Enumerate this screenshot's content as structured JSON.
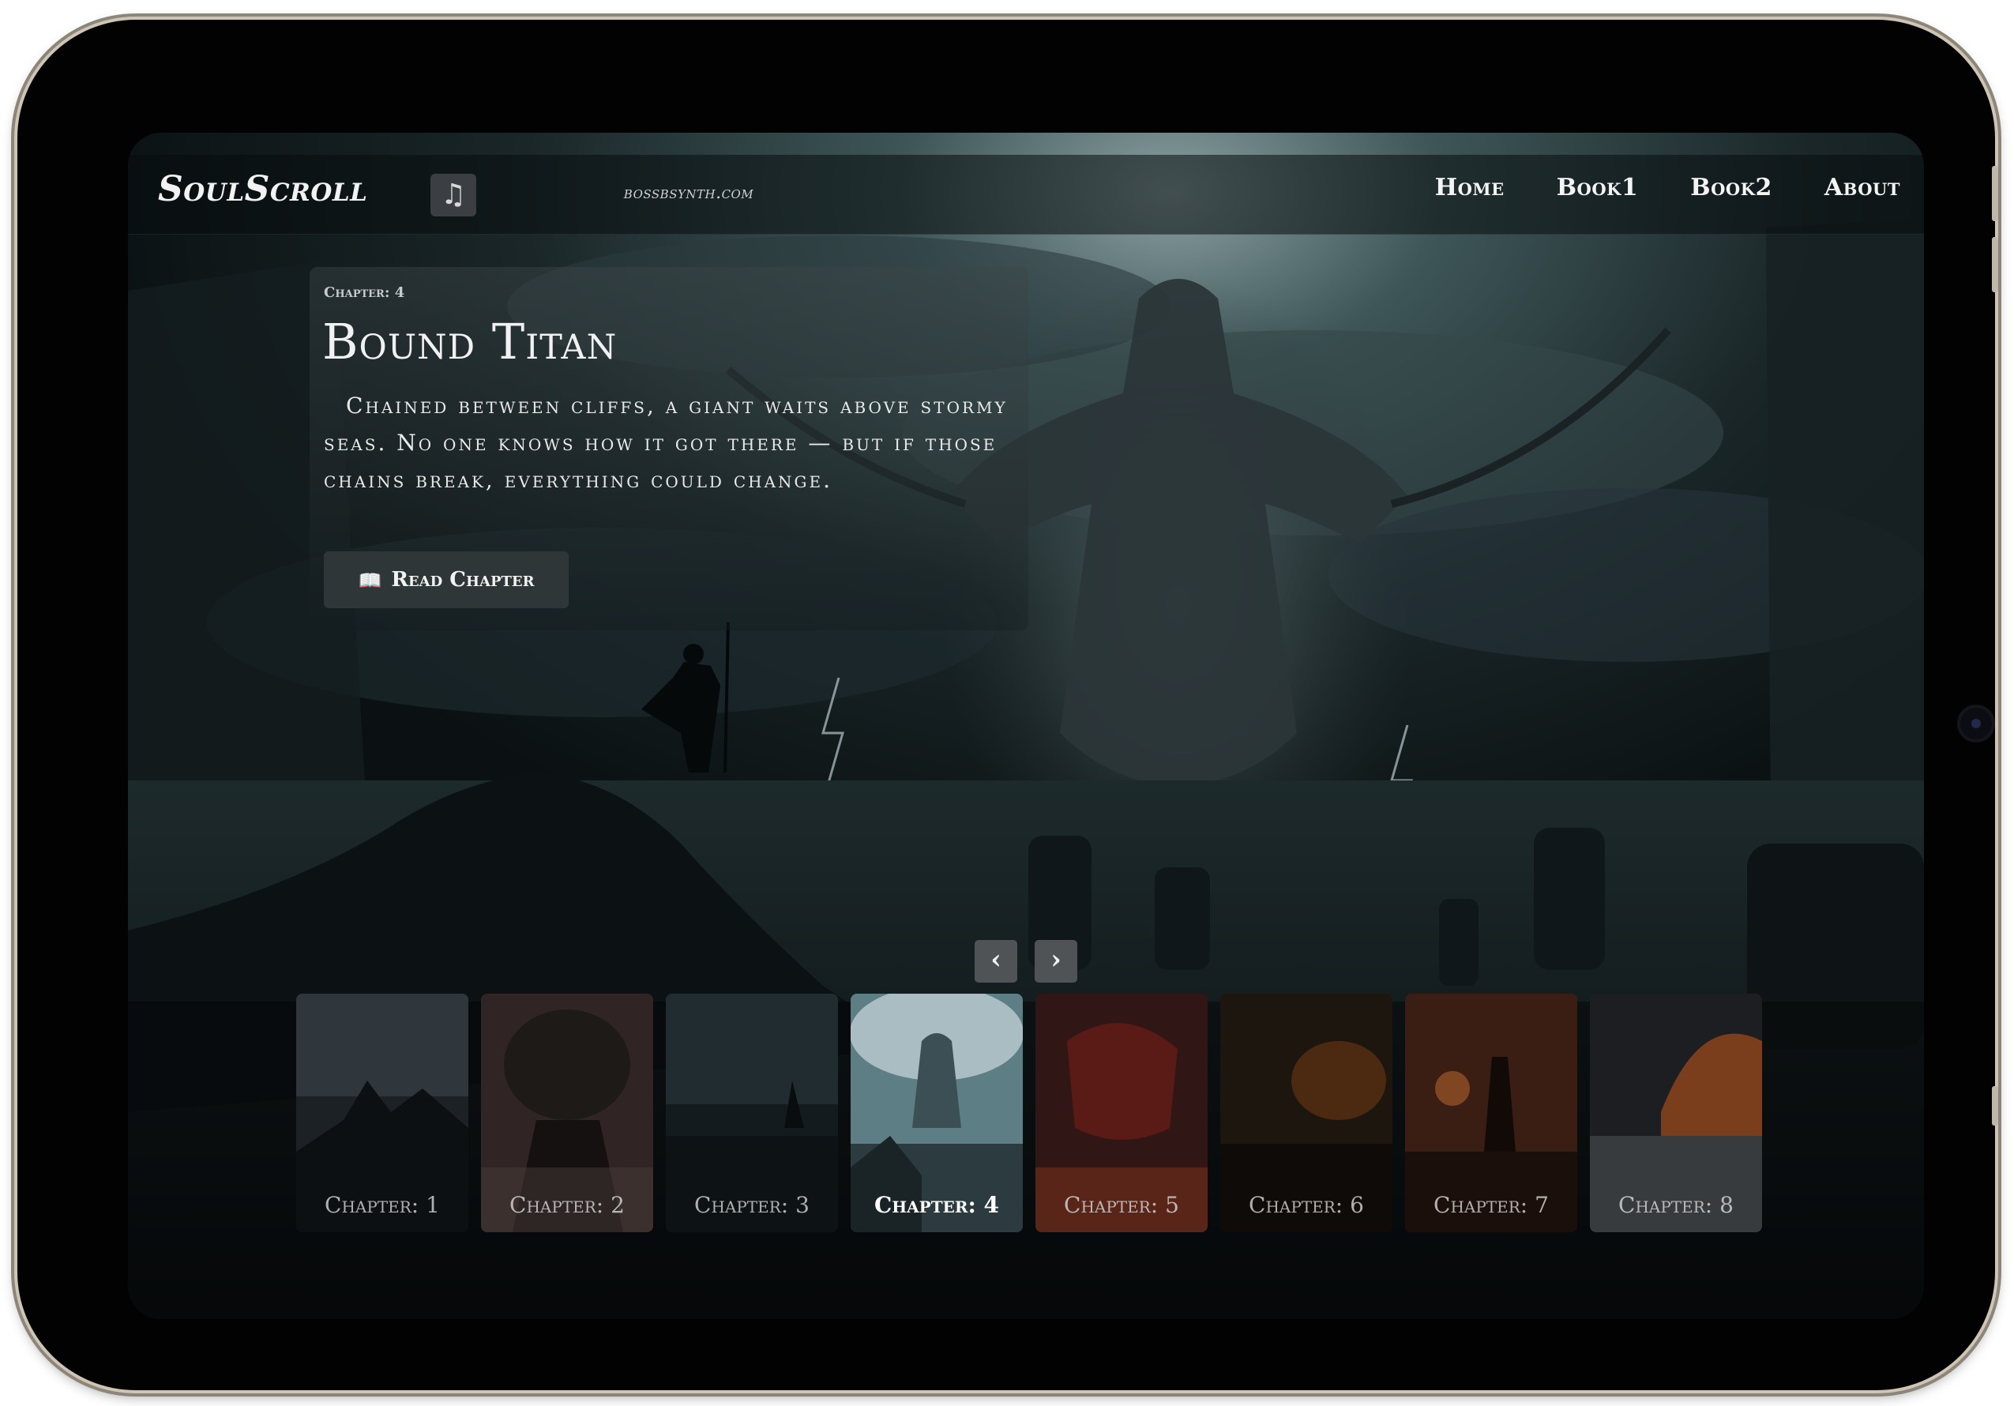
{
  "nav": {
    "logo": "SoulScroll",
    "site_url": "bossbsynth.com",
    "music_icon": "music-note-icon",
    "links": [
      "Home",
      "Book1",
      "Book2",
      "About"
    ]
  },
  "hero": {
    "chapter_tag": "Chapter: 4",
    "title": "Bound Titan",
    "description": "Chained between cliffs, a giant waits above stormy seas. No one knows how it got there — but if those chains break, everything could change.",
    "button_label": "Read Chapter",
    "button_icon": "open-book-icon"
  },
  "carousel": {
    "prev_symbol": "‹",
    "next_symbol": "›",
    "active_index": 3,
    "thumbnails": [
      {
        "label": "Chapter: 1"
      },
      {
        "label": "Chapter: 2"
      },
      {
        "label": "Chapter: 3"
      },
      {
        "label": "Chapter: 4"
      },
      {
        "label": "Chapter: 5"
      },
      {
        "label": "Chapter: 6"
      },
      {
        "label": "Chapter: 7"
      },
      {
        "label": "Chapter: 8"
      }
    ]
  },
  "colors": {
    "frame_bezel": "#020202",
    "frame_edge": "#cfc5b4",
    "nav_text": "#f4f4f4",
    "button_bg": "#2f3638",
    "arrow_bg": "#4f5356"
  }
}
